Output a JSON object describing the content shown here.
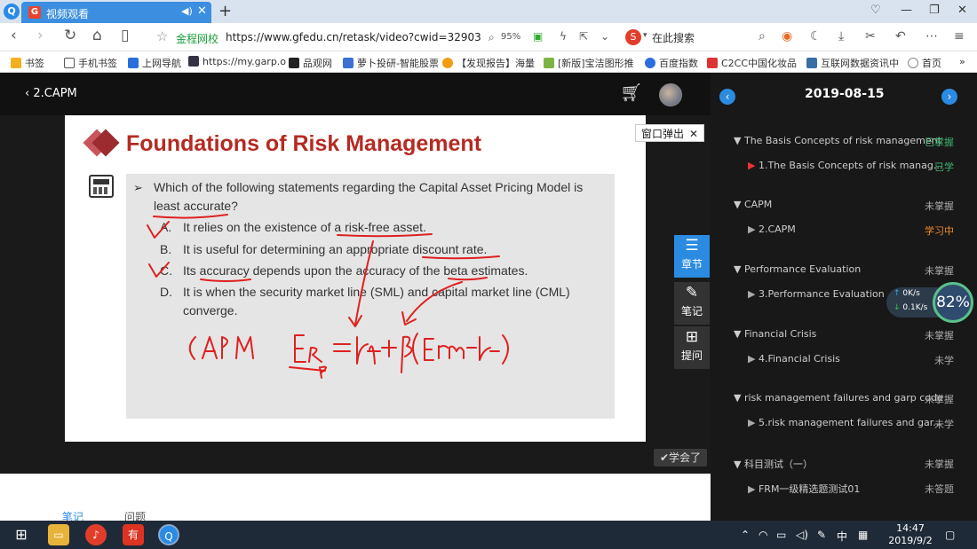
{
  "browser": {
    "tab_title": "视频观看",
    "new_tab": "+",
    "url_security": "金程网校",
    "url": "https://www.gfedu.cn/retask/video?cwid=32903",
    "zoom": "95%",
    "search_engine_label": "在此搜索",
    "bookmarks": [
      "书签",
      "手机书签",
      "上网导航",
      "https://my.garp.o",
      "品观网",
      "萝卜投研-智能股票",
      "【发现报告】海量",
      "[新版]宝洁图形推",
      "百度指数",
      "C2CC中国化妆品",
      "互联网数据资讯中",
      "首页"
    ]
  },
  "player": {
    "back_label": "2.CAPM",
    "popup_label": "窗口弹出",
    "learned_label": "学会了",
    "tools": [
      {
        "label": "章节"
      },
      {
        "label": "笔记"
      },
      {
        "label": "提问"
      }
    ]
  },
  "slide": {
    "title": "Foundations of Risk Management",
    "question": "Which of the following statements regarding the Capital Asset Pricing Model is least accurate?",
    "options": [
      {
        "letter": "A.",
        "text": "It relies on the existence of a risk-free asset."
      },
      {
        "letter": "B.",
        "text": "It is useful for determining an appropriate discount rate."
      },
      {
        "letter": "C.",
        "text": "Its accuracy depends upon the accuracy of the beta estimates."
      },
      {
        "letter": "D.",
        "text": "It is when the security market line (SML) and capital market line (CML) converge."
      }
    ],
    "handwriting_capm": "CAPM",
    "handwriting_formula": "E_Rp = Rf + β(Erm - Rf)"
  },
  "speed_widget": {
    "upload": "0K/s",
    "download": "0.1K/s",
    "percent": "82%"
  },
  "panel": {
    "date": "2019-08-15",
    "chapters": [
      {
        "title": "The Basis Concepts of risk management",
        "status": "已掌握",
        "lesson": "1.The Basis Concepts of risk manag...",
        "lesson_status": "已学"
      },
      {
        "title": "CAPM",
        "status": "未掌握",
        "lesson": "2.CAPM",
        "lesson_status": "学习中"
      },
      {
        "title": "Performance Evaluation",
        "status": "未掌握",
        "lesson": "3.Performance Evaluation",
        "lesson_status": ""
      },
      {
        "title": "Financial Crisis",
        "status": "未掌握",
        "lesson": "4.Financial Crisis",
        "lesson_status": "未学"
      },
      {
        "title": "risk management failures and garp code",
        "status": "未掌握",
        "lesson": "5.risk management failures and gar...",
        "lesson_status": "未学"
      },
      {
        "title": "科目测试（一）",
        "status": "未掌握",
        "lesson": "FRM一级精选题测试01",
        "lesson_status": "未答题"
      }
    ],
    "status_colors": {
      "mastered": "#3cb371",
      "learning": "#f28c28",
      "default": "#aaaaaa"
    }
  },
  "bottom_tabs": [
    "笔记",
    "问题"
  ],
  "taskbar": {
    "time": "14:47",
    "date": "2019/9/2",
    "ime": "中"
  }
}
